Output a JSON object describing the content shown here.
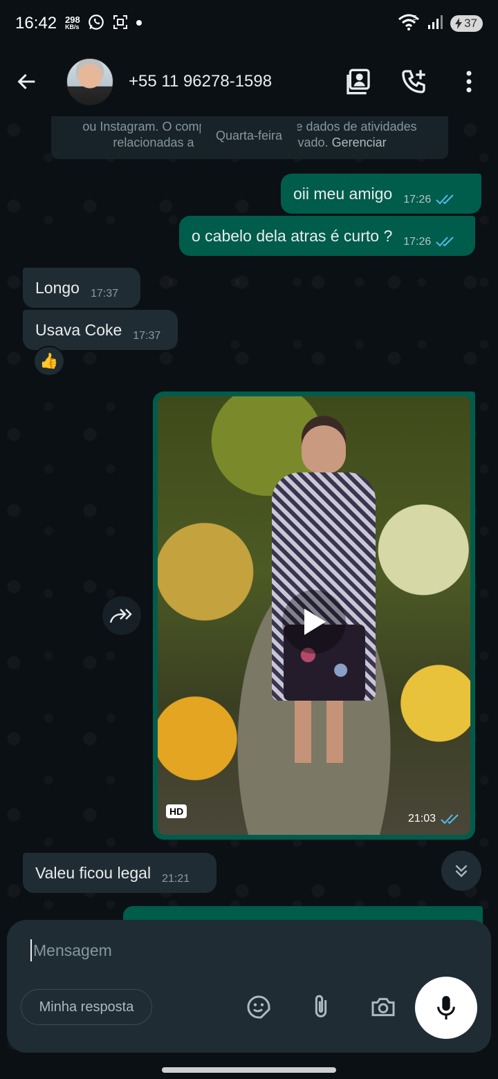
{
  "status_bar": {
    "time": "16:42",
    "net_speed": "298",
    "net_unit": "KB/s",
    "battery": "37",
    "icons": [
      "whatsapp-icon",
      "screenshot-icon",
      "dot-icon",
      "wifi-icon",
      "signal-icon",
      "battery-icon"
    ]
  },
  "header": {
    "contact": "+55 11 96278-1598",
    "icons": [
      "back-arrow-icon",
      "contact-card-icon",
      "add-call-icon",
      "more-vert-icon"
    ]
  },
  "system_notice": {
    "line1": "ou Instagram. O comp",
    "line1_end": "e dados de atividades",
    "line2": "relacionadas a",
    "line2_end": "vado.",
    "link": "Gerenciar"
  },
  "date_divider": "Quarta-feira",
  "messages": [
    {
      "direction": "out",
      "text": "oii meu amigo",
      "time": "17:26",
      "status": "read"
    },
    {
      "direction": "out",
      "text": "o cabelo dela atras é curto ?",
      "time": "17:26",
      "status": "read"
    },
    {
      "direction": "in",
      "text": "Longo",
      "time": "17:37"
    },
    {
      "direction": "in",
      "text": "Usava Coke",
      "time": "17:37",
      "reaction": "👍"
    },
    {
      "direction": "out",
      "type": "video",
      "badge": "HD",
      "time": "21:03",
      "status": "read"
    },
    {
      "direction": "in",
      "text": "Valeu ficou legal",
      "time": "21:21"
    }
  ],
  "composer": {
    "placeholder": "Mensagem",
    "quick_reply": "Minha resposta",
    "icons": [
      "sticker-icon",
      "attach-icon",
      "camera-icon",
      "mic-icon"
    ]
  },
  "colors": {
    "background": "#0b1014",
    "outgoing_bubble": "#005c4b",
    "incoming_bubble": "#202c33",
    "read_ticks": "#53bdeb"
  }
}
